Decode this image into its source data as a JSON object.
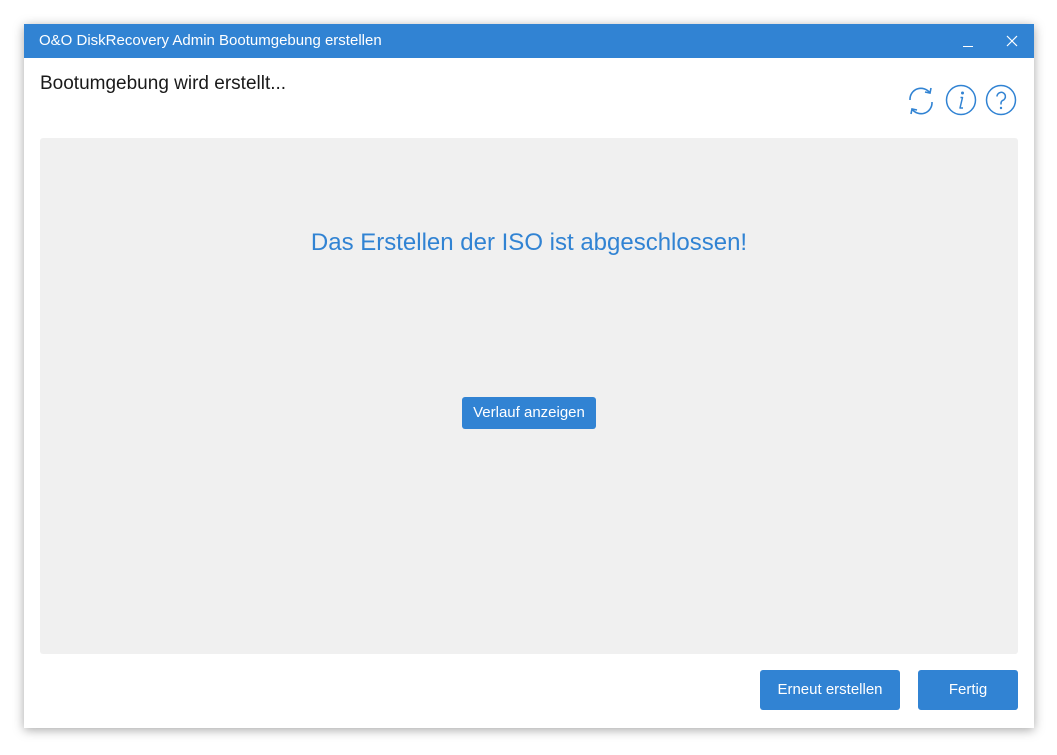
{
  "window": {
    "title": "O&O DiskRecovery Admin Bootumgebung erstellen"
  },
  "header": {
    "text": "Bootumgebung wird erstellt...",
    "icons": [
      "refresh-icon",
      "info-icon",
      "help-icon"
    ]
  },
  "content": {
    "status_message": "Das Erstellen der ISO ist abgeschlossen!",
    "history_button_label": "Verlauf anzeigen"
  },
  "footer": {
    "recreate_label": "Erneut erstellen",
    "finish_label": "Fertig"
  },
  "colors": {
    "accent": "#3183d3",
    "panel_background": "#f0f0f0",
    "text": "#1a1a1a"
  }
}
